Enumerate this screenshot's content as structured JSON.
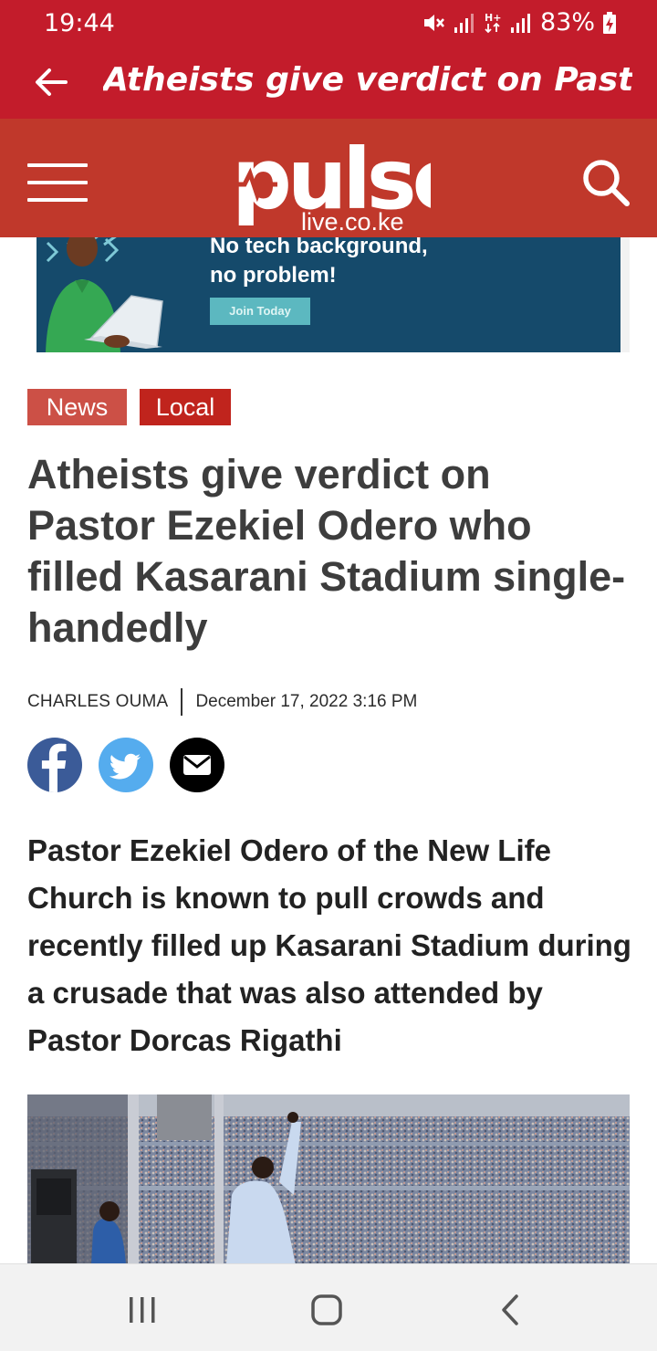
{
  "status_bar": {
    "time": "19:44",
    "battery": "83%",
    "icons": [
      "mute-icon",
      "signal-icon",
      "hplus-data-icon",
      "signal-icon",
      "battery-charging-icon"
    ]
  },
  "app_bar": {
    "title": "Atheists give verdict on Pastor ...",
    "back_icon": "back-arrow-icon"
  },
  "site_header": {
    "logo_text": "pulse",
    "logo_domain": "live.co.ke",
    "menu_icon": "hamburger-menu-icon",
    "search_icon": "search-icon"
  },
  "ad": {
    "headline_line1": "No tech background,",
    "headline_line2": "no problem!",
    "cta": "Join Today"
  },
  "article": {
    "tags": [
      "News",
      "Local"
    ],
    "headline": "Atheists give verdict on Pastor Ezekiel Odero who filled Kasarani Stadium single-handedly",
    "author": "CHARLES OUMA",
    "date": "December 17, 2022 3:16 PM",
    "share_icons": [
      "facebook-icon",
      "twitter-icon",
      "email-icon"
    ],
    "lead": "Pastor Ezekiel Odero of the New Life Church is known to pull crowds and recently filled up Kasarani Stadium during a crusade that was also attended by Pastor Dorcas Rigathi"
  },
  "nav_bar": {
    "buttons": [
      "recent-apps-icon",
      "home-icon",
      "back-icon"
    ]
  },
  "colors": {
    "brand_red": "#c31c2b",
    "header_red": "#c0382b",
    "tag_news": "#cc5046",
    "tag_local": "#c0241d",
    "facebook": "#3b5b98",
    "twitter": "#55acee"
  }
}
